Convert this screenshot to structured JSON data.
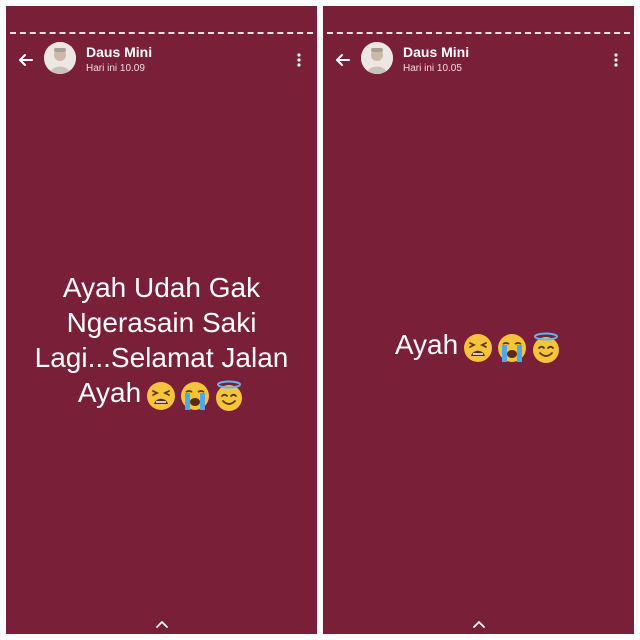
{
  "stories": [
    {
      "user_name": "Daus Mini",
      "timestamp": "Hari ini 10.09",
      "text": "Ayah Udah Gak Ngerasain Saki Lagi...Selamat Jalan Ayah",
      "emojis": [
        "tired-face-emoji",
        "loudly-crying-face-emoji",
        "smiling-face-with-halo-emoji"
      ]
    },
    {
      "user_name": "Daus Mini",
      "timestamp": "Hari ini 10.05",
      "text": "Ayah",
      "emojis": [
        "tired-face-emoji",
        "loudly-crying-face-emoji",
        "smiling-face-with-halo-emoji"
      ]
    }
  ],
  "colors": {
    "story_background": "#7a1f38",
    "text": "#ffffff",
    "emoji_yellow": "#f6c33c"
  },
  "icons": {
    "back": "arrow-left-icon",
    "menu": "more-vertical-icon",
    "swipe_up": "chevron-up-icon"
  }
}
